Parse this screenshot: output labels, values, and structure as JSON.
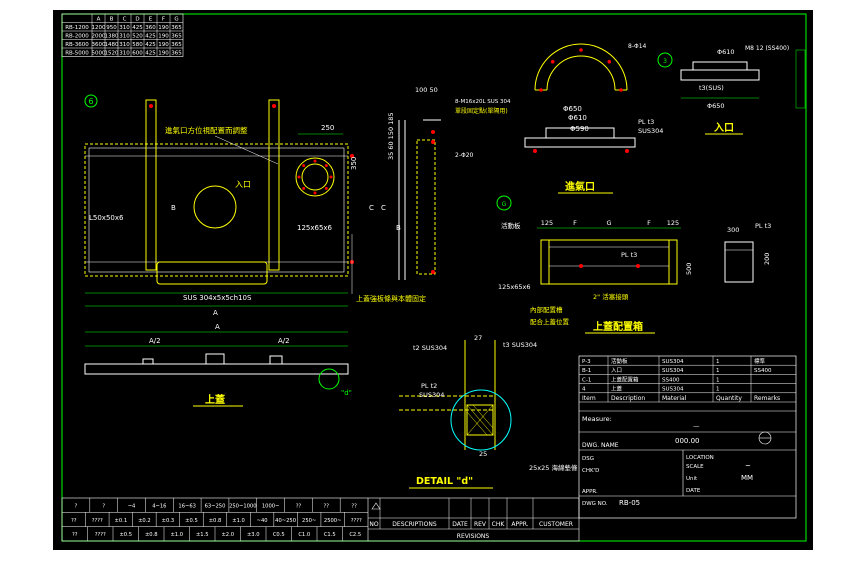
{
  "colors": {
    "background": "#000000",
    "border": "#00ff00",
    "drawing": "#ffffff",
    "dimension": "#00ff00",
    "part": "#ff0000",
    "text": "#ffff00",
    "detail_circle": "#00ffff",
    "frame": "#ffffff"
  },
  "spec_table": {
    "header": [
      "",
      "A",
      "B",
      "C",
      "D",
      "E",
      "F",
      "G"
    ],
    "rows": [
      [
        "RB-1200",
        "1200",
        "950",
        "310",
        "425",
        "360",
        "190",
        "365"
      ],
      [
        "RB-2000",
        "2000",
        "1380",
        "310",
        "520",
        "425",
        "190",
        "365"
      ],
      [
        "RB-3600",
        "3600",
        "1480",
        "310",
        "580",
        "425",
        "190",
        "365"
      ],
      [
        "RB-5000",
        "5000",
        "1520",
        "310",
        "600",
        "425",
        "190",
        "365"
      ]
    ]
  },
  "labels": {
    "section_6": "6",
    "inlet_note": "進氣口方位視配置而調整",
    "inlet_cn": "入口",
    "dim_250": "250",
    "dim_350": "350",
    "angle_main": "L50x50x6",
    "angle_right": "125x65x6",
    "rod_note": "SUS 304x5x5ch10S",
    "stiff_note": "上蓋強板條與本體固定",
    "dim_b": "B",
    "dim_c": "C",
    "dim_a_top": "A",
    "dim_a_bottom": "A",
    "dim_a2_left": "A/2",
    "dim_a2_right": "A/2",
    "cover_title": "上蓋",
    "d_marker": "\"d\"",
    "side_top_dims": "100 50",
    "side_left_dims": "35 60 150 185",
    "side_note1": "8-M16x20L SUS 304",
    "side_note2": "單段固定點(單隔用)",
    "side_2_phi20": "2-Φ20",
    "side_dim_b": "B",
    "side_dim_c": "C",
    "arc_note": "8-Φ14",
    "inlet_dim_1": "Φ650",
    "inlet_dim_2": "Φ610",
    "inlet_dim_3": "Φ590",
    "inlet_pl": "PL t3",
    "inlet_sus": "SUS304",
    "inlet_title": "進氣口",
    "entry_phi": "Φ610",
    "entry_m": "M8 12 (SS400)",
    "entry_t3": "t3(SUS)",
    "entry_phi2": "Φ650",
    "entry_title": "入口",
    "g_marker": "G",
    "box_dims_top": [
      "125",
      "F",
      "G",
      "F",
      "125"
    ],
    "box_note1": "活動板",
    "box_pl": "PL t3",
    "box_angle": "125x65x6",
    "box_note2": "內部配置槽",
    "box_note3": "配合上蓋位置",
    "box_note4": "2\" 活塞接頭",
    "box_dim_side": "500",
    "box_title": "上蓋配置箱",
    "box_right_pl": "PL t3",
    "box_right_300": "300",
    "box_right_dim": "200",
    "detail_t2": "t2 SUS304",
    "detail_t3": "t3 SUS304",
    "detail_27": "27",
    "detail_pl": "PL t2",
    "detail_sus": "SUS304",
    "detail_25": "25",
    "detail_gasket": "25x25 海綿墊條",
    "detail_title": "DETAIL \"d\"",
    "parts_rows": [
      [
        "P-3",
        "活動板",
        "SUS304",
        "1",
        "標準"
      ],
      [
        "B-1",
        "入口",
        "SUS304",
        "1",
        "SS400"
      ],
      [
        "C-1",
        "上蓋配置箱",
        "SS400",
        "1",
        ""
      ],
      [
        "4",
        "上蓋",
        "SUS304",
        "1",
        ""
      ]
    ],
    "parts_header": [
      "Item",
      "Description",
      "Material",
      "Quantity",
      "Remarks"
    ],
    "measure_label": "Measure:",
    "measure_val": "—",
    "dwg_no_label": "DWG. NAME",
    "dwg_no_val": "000.00",
    "unit_label": "LOCATION",
    "scale_label": "SCALE",
    "scale_val": "~",
    "unit_text": "Unit",
    "unit_val": "MM",
    "date_label": "DATE",
    "appr_label": "APPR.",
    "dwg_label": "DWG NO.",
    "dwg_val": "RB-05",
    "chk_label": "CHK'D",
    "dsg_label": "DSG",
    "revision_headers": [
      "NO",
      "DESCRIPTIONS",
      "DATE",
      "REV",
      "CHK",
      "APPR.",
      "CUSTOMER"
    ],
    "revisions_label": "REVISIONS",
    "tol_header": [
      "?",
      "?",
      "~4",
      "4~16",
      "16~63",
      "63~250",
      "250~1000",
      "1000~",
      "??",
      "??",
      "??"
    ],
    "tol_row1": [
      "??",
      "????",
      "±0.1",
      "±0.2",
      "±0.3",
      "±0.5",
      "±0.8",
      "±1.0",
      "~40",
      "40~250",
      "250~",
      "2500~",
      "????"
    ],
    "tol_row2": [
      "??",
      "????",
      "±0.5",
      "±0.8",
      "±1.0",
      "±1.5",
      "±2.0",
      "±3.0",
      "C0.5",
      "C1.0",
      "C1.5",
      "C2.5"
    ]
  }
}
